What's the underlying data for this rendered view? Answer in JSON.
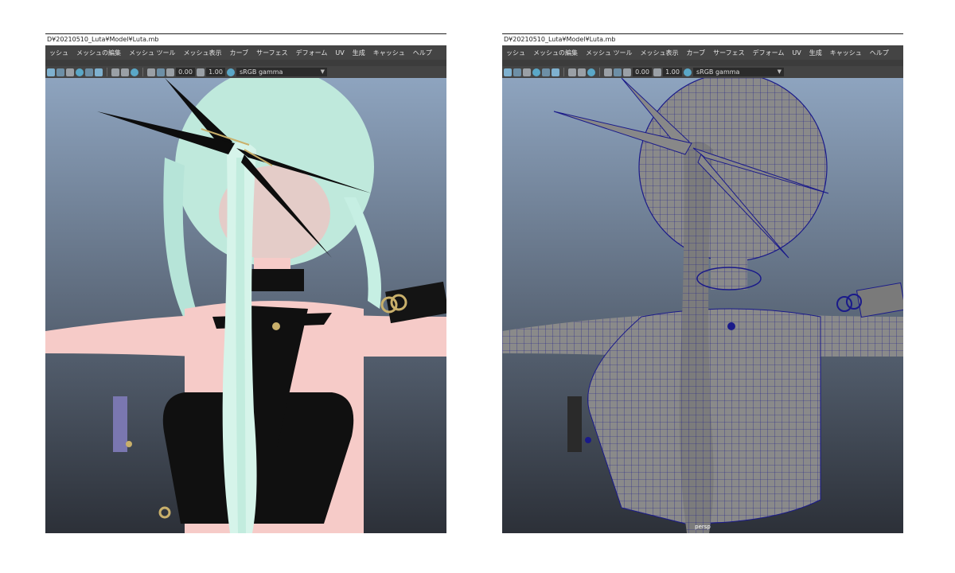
{
  "left_window": {
    "title": "D¥20210510_Luta¥Model¥Luta.mb",
    "menu": [
      "ッシュ",
      "メッシュの編集",
      "メッシュ ツール",
      "メッシュ表示",
      "カーブ",
      "サーフェス",
      "デフォーム",
      "UV",
      "生成",
      "キャッシュ",
      "ヘルプ"
    ],
    "toolbar": {
      "exposure": "0.00",
      "gamma": "1.00",
      "colorspace": "sRGB gamma"
    }
  },
  "right_window": {
    "title": "D¥20210510_Luta¥Model¥Luta.mb",
    "menu": [
      "ッシュ",
      "メッシュの編集",
      "メッシュ ツール",
      "メッシュ表示",
      "カーブ",
      "サーフェス",
      "デフォーム",
      "UV",
      "生成",
      "キャッシュ",
      "ヘルプ"
    ],
    "toolbar": {
      "exposure": "0.00",
      "gamma": "1.00",
      "colorspace": "sRGB gamma"
    },
    "camera_label": "persp"
  },
  "colors": {
    "viewport_top": "#8ea4bf",
    "viewport_bottom": "#2c3038",
    "menubar": "#444444",
    "hair": "#bfe9dc",
    "skin": "#f6cbc8",
    "cloth": "#101010",
    "wire_mesh": "#8a8a8a",
    "wire_edges": "#1a1a8a",
    "gold": "#c9b06b"
  }
}
